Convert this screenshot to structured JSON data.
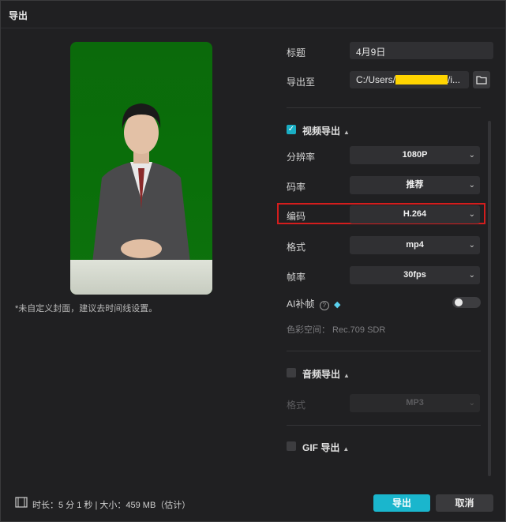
{
  "window": {
    "title": "导出"
  },
  "preview": {
    "cover_note": "*未自定义封面，建议去时间线设置。"
  },
  "fields": {
    "title_label": "标题",
    "title_value": "4月9日",
    "export_to_label": "导出至",
    "export_to_prefix": "C:/Users/",
    "export_to_suffix": "/i..."
  },
  "video_export": {
    "section_label": "视频导出",
    "checked": true,
    "resolution_label": "分辨率",
    "resolution_value": "1080P",
    "bitrate_label": "码率",
    "bitrate_value": "推荐",
    "codec_label": "编码",
    "codec_value": "H.264",
    "format_label": "格式",
    "format_value": "mp4",
    "framerate_label": "帧率",
    "framerate_value": "30fps",
    "ai_frame_label": "AI补帧",
    "ai_frame_enabled": false,
    "color_space_text": "色彩空间： Rec.709 SDR"
  },
  "audio_export": {
    "section_label": "音频导出",
    "checked": false,
    "format_label": "格式",
    "format_value": "MP3"
  },
  "gif_export": {
    "section_label": "GIF 导出",
    "checked": false
  },
  "footer": {
    "info_text": "时长：5 分 1 秒 | 大小：459 MB（估计）",
    "export_button": "导出",
    "cancel_button": "取消"
  },
  "colors": {
    "accent": "#1ab6cd",
    "highlight_border": "#d41d1d",
    "preview_bg": "#0b6a0b"
  }
}
